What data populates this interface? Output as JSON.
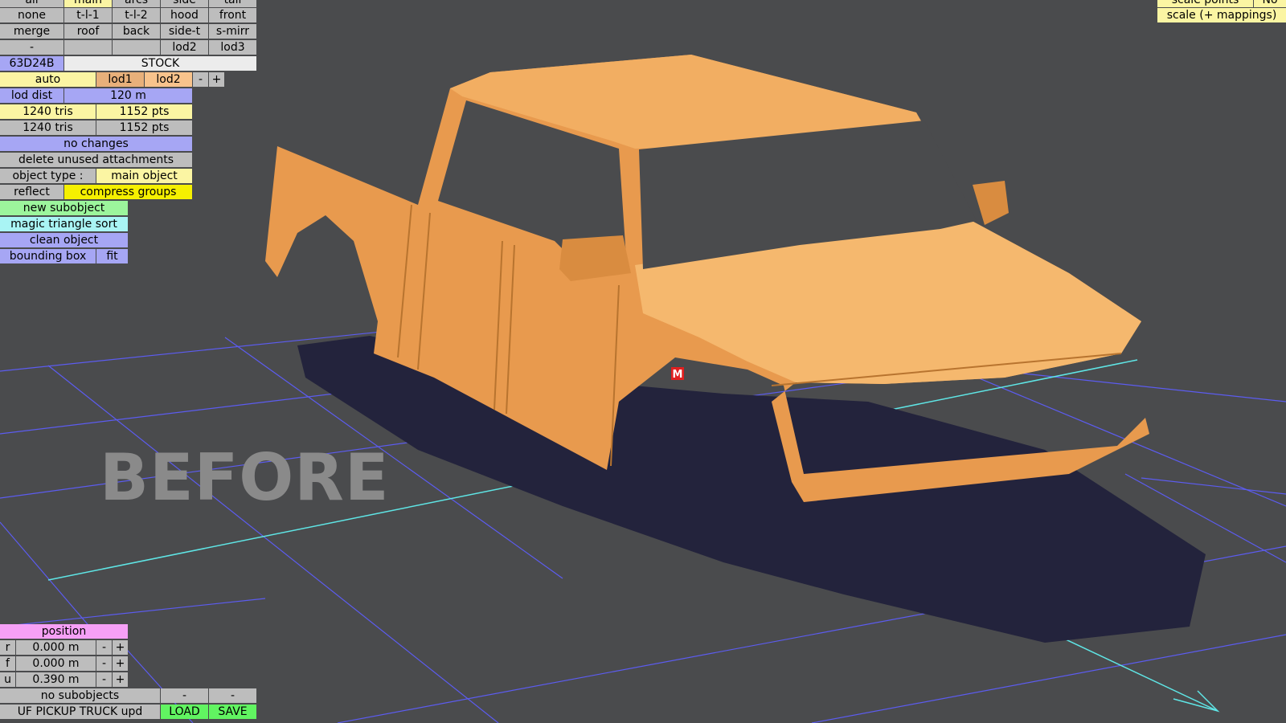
{
  "top_row": [
    "all",
    "main",
    "arcs",
    "side",
    "tail"
  ],
  "grid": {
    "row1": [
      "none",
      "t-l-1",
      "t-l-2",
      "hood",
      "front"
    ],
    "row2": [
      "merge",
      "roof",
      "back",
      "side-t",
      "s-mirr"
    ],
    "row3": [
      "-",
      "",
      "",
      "lod2",
      "lod3"
    ]
  },
  "object_code": "63D24B",
  "object_name": "STOCK",
  "lod": {
    "auto": "auto",
    "lod1": "lod1",
    "lod2": "lod2",
    "minus": "-",
    "plus": "+"
  },
  "lod_dist": {
    "label": "lod dist",
    "value": "120 m"
  },
  "stats1": {
    "tris": "1240 tris",
    "pts": "1152 pts"
  },
  "stats2": {
    "tris": "1240 tris",
    "pts": "1152 pts"
  },
  "status": "no changes",
  "delete_unused": "delete unused attachments",
  "object_type": {
    "label": "object type :",
    "value": "main object"
  },
  "reflect": "reflect",
  "compress_groups": "compress groups",
  "new_subobject": "new subobject",
  "magic_triangle_sort": "magic triangle sort",
  "clean_object": "clean object",
  "bounding_box": {
    "label": "bounding box",
    "fit": "fit"
  },
  "top_right": {
    "scale_points": "scale points",
    "no": "No",
    "scale_mappings": "scale (+ mappings)"
  },
  "viewport": {
    "before_label": "BEFORE",
    "marker": "M",
    "body_color": "#f0a24f"
  },
  "position": {
    "title": "position",
    "rows": [
      {
        "axis": "r",
        "value": "0.000 m",
        "minus": "-",
        "plus": "+"
      },
      {
        "axis": "f",
        "value": "0.000 m",
        "minus": "-",
        "plus": "+"
      },
      {
        "axis": "u",
        "value": "0.390 m",
        "minus": "-",
        "plus": "+"
      }
    ]
  },
  "subobjects": {
    "label": "no subobjects",
    "dash1": "-",
    "dash2": "-"
  },
  "file": {
    "name": "UF PICKUP TRUCK upd",
    "load": "LOAD",
    "save": "SAVE"
  }
}
